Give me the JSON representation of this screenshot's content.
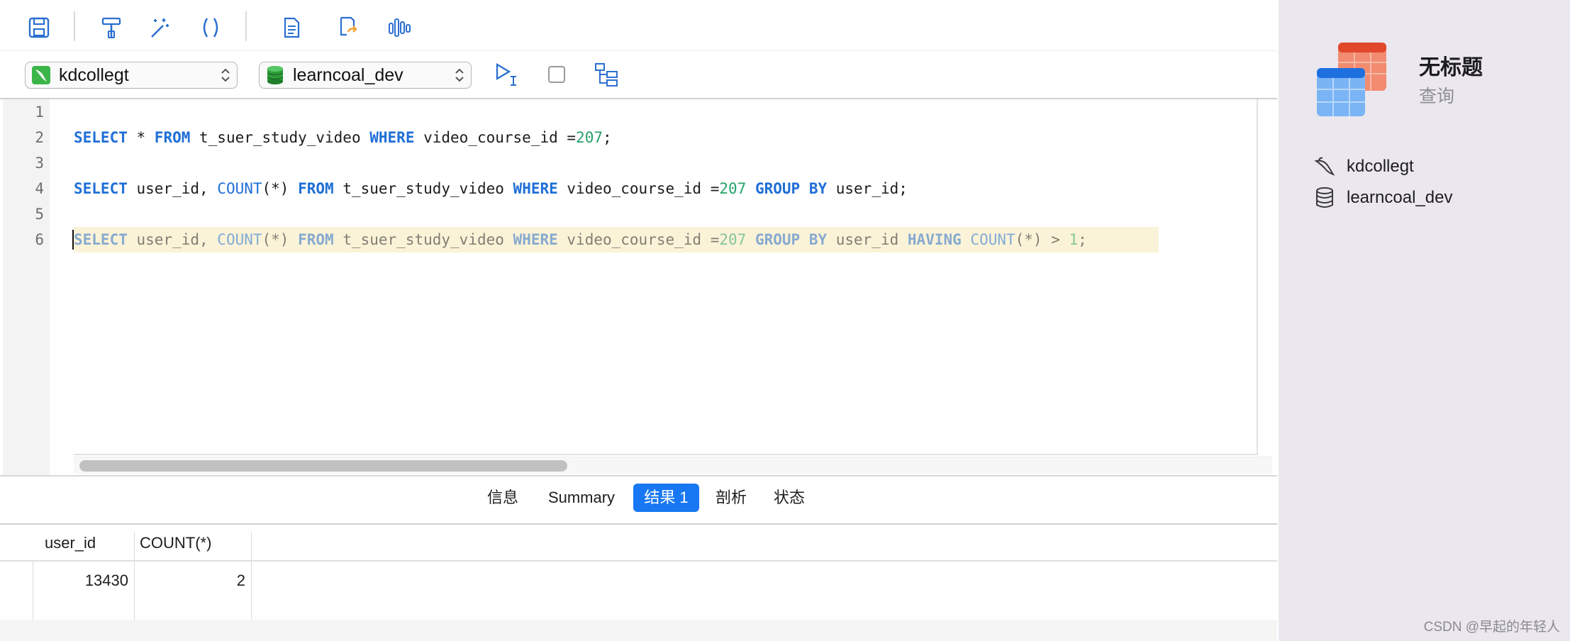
{
  "toolbar": {
    "icons": [
      "save-icon",
      "format-icon",
      "beautify-icon",
      "parentheses-icon",
      "document-icon",
      "export-icon",
      "chart-icon"
    ]
  },
  "connection_bar": {
    "connection": "kdcollegt",
    "database": "learncoal_dev",
    "actions": [
      "run-selected-icon",
      "stop-icon",
      "explain-icon"
    ]
  },
  "editor": {
    "line_numbers": [
      "1",
      "2",
      "3",
      "4",
      "5",
      "6"
    ],
    "lines": [
      "",
      "SELECT * FROM t_suer_study_video WHERE video_course_id =207;",
      "",
      "SELECT user_id, COUNT(*) FROM t_suer_study_video WHERE video_course_id =207 GROUP BY user_id;",
      "",
      "SELECT user_id, COUNT(*) FROM t_suer_study_video WHERE video_course_id =207 GROUP BY user_id HAVING COUNT(*) > 1;"
    ]
  },
  "result_tabs": [
    {
      "label": "信息",
      "active": false
    },
    {
      "label": "Summary",
      "active": false
    },
    {
      "label": "结果 1",
      "active": true
    },
    {
      "label": "剖析",
      "active": false
    },
    {
      "label": "状态",
      "active": false
    }
  ],
  "result_grid": {
    "columns": [
      "user_id",
      "COUNT(*)"
    ],
    "rows": [
      [
        "13430",
        "2"
      ]
    ]
  },
  "sidebar": {
    "title": "无标题",
    "subtitle": "查询",
    "items": [
      {
        "label": "kdcollegt",
        "icon": "mysql-dolphin-icon"
      },
      {
        "label": "learncoal_dev",
        "icon": "database-icon"
      }
    ]
  },
  "watermark": "CSDN @早起的年轻人",
  "colors": {
    "keyword": "#1f6fd6",
    "number": "#26a269",
    "active_tab": "#1877f2",
    "highlight_line": "#fbf3d8",
    "sidebar_bg": "#ebe7ee"
  }
}
